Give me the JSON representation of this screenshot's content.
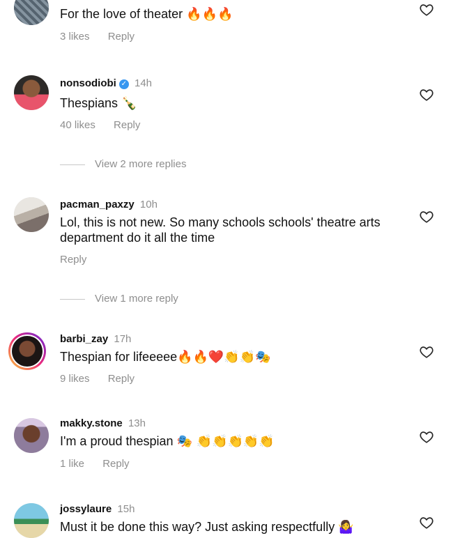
{
  "comments": [
    {
      "text": "For the love of theater",
      "emoji": "🔥🔥🔥",
      "likes": "3 likes",
      "reply": "Reply"
    },
    {
      "username": "nonsodiobi",
      "verified": true,
      "time": "14h",
      "text": "Thespians",
      "emoji": "🍾",
      "likes": "40 likes",
      "reply": "Reply",
      "view_replies": "View 2 more replies"
    },
    {
      "username": "pacman_paxzy",
      "time": "10h",
      "text": "Lol, this is not new. So many schools schools' theatre arts department do it all the time",
      "reply": "Reply",
      "view_replies": "View 1 more reply"
    },
    {
      "username": "barbi_zay",
      "time": "17h",
      "text": "Thespian for lifeeeee",
      "emoji": "🔥🔥❤️👏👏🎭",
      "likes": "9 likes",
      "reply": "Reply"
    },
    {
      "username": "makky.stone",
      "time": "13h",
      "text": "I'm a proud thespian",
      "emoji": "🎭 👏👏👏👏👏",
      "likes": "1 like",
      "reply": "Reply"
    },
    {
      "username": "jossylaure",
      "time": "15h",
      "text": "Must it be done this way? Just asking respectfully",
      "emoji": "🤷‍♀️"
    }
  ],
  "icons": {
    "heart": "heart-outline-icon",
    "verified": "verified-badge-icon"
  },
  "colors": {
    "secondary_text": "#8e8e8e",
    "verified_blue": "#3897f0"
  }
}
